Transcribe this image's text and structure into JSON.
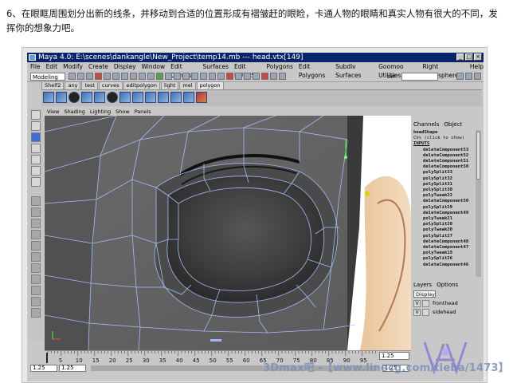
{
  "doc": {
    "paragraph": "6、在眼眶周围划分出新的线条，并移动到合适的位置形成有褶皱赶的眼睑，卡通人物的眼睛和真实人物有很大的不同，发挥你的想象力吧。"
  },
  "window": {
    "title": "Maya 4.0: E:\\scenes\\dankangle\\New_Project\\temp14.mb  ---  head.vtx[149]"
  },
  "menu": [
    "File",
    "Edit",
    "Modify",
    "Create",
    "Display",
    "Window",
    "Edit Curves",
    "Surfaces",
    "Edit NURBS",
    "Polygons",
    "Edit Polygons",
    "Subdiv Surfaces",
    "Goomoo Utilities",
    "Right Hemisphere",
    "Help"
  ],
  "status": {
    "mode": "Modeling",
    "field_label": "sel"
  },
  "shelf": {
    "tabs": [
      "Shelf2",
      "any",
      "test",
      "curves",
      "editpolygon",
      "light",
      "mel",
      "polygon"
    ],
    "active_tab": "polygon"
  },
  "viewport": {
    "menu": [
      "View",
      "Shading",
      "Lighting",
      "Show",
      "Panels"
    ]
  },
  "channel_box": {
    "tabs": [
      "Channels",
      "Object"
    ],
    "node": "headShape",
    "cvs": "CVs (click to show)",
    "inputs_header": "INPUTS",
    "inputs": [
      "deleteComponent53",
      "deleteComponent52",
      "deleteComponent51",
      "deleteComponent50",
      "polySplit33",
      "polySplit32",
      "polySplit31",
      "polySplit30",
      "polyTweak22",
      "deleteComponent50",
      "polySplit29",
      "deleteComponent49",
      "polyTweak21",
      "polySplit28",
      "polyTweak20",
      "polySplit27",
      "deleteComponent48",
      "deleteComponent47",
      "polyTweak19",
      "polySplit26",
      "deleteComponent46"
    ]
  },
  "layers": {
    "tabs": [
      "Layers",
      "Options"
    ],
    "display": "Display",
    "rows": [
      {
        "v": "V",
        "name": "fronthead"
      },
      {
        "v": "V",
        "name": "sidehead"
      }
    ]
  },
  "timeline": {
    "ticks": [
      "5",
      "10",
      "15",
      "20",
      "25",
      "30",
      "35",
      "40",
      "45",
      "50",
      "55",
      "60",
      "65",
      "70",
      "75",
      "80",
      "85",
      "90",
      "95"
    ],
    "current": "1.25",
    "range_start": "1.25",
    "range_start2": "1.25",
    "range_end": "1.25",
    "range_end2": "1.25"
  },
  "watermark": {
    "text": "3Dmax吧 -【www.linecg.com/tieba/1473】"
  }
}
